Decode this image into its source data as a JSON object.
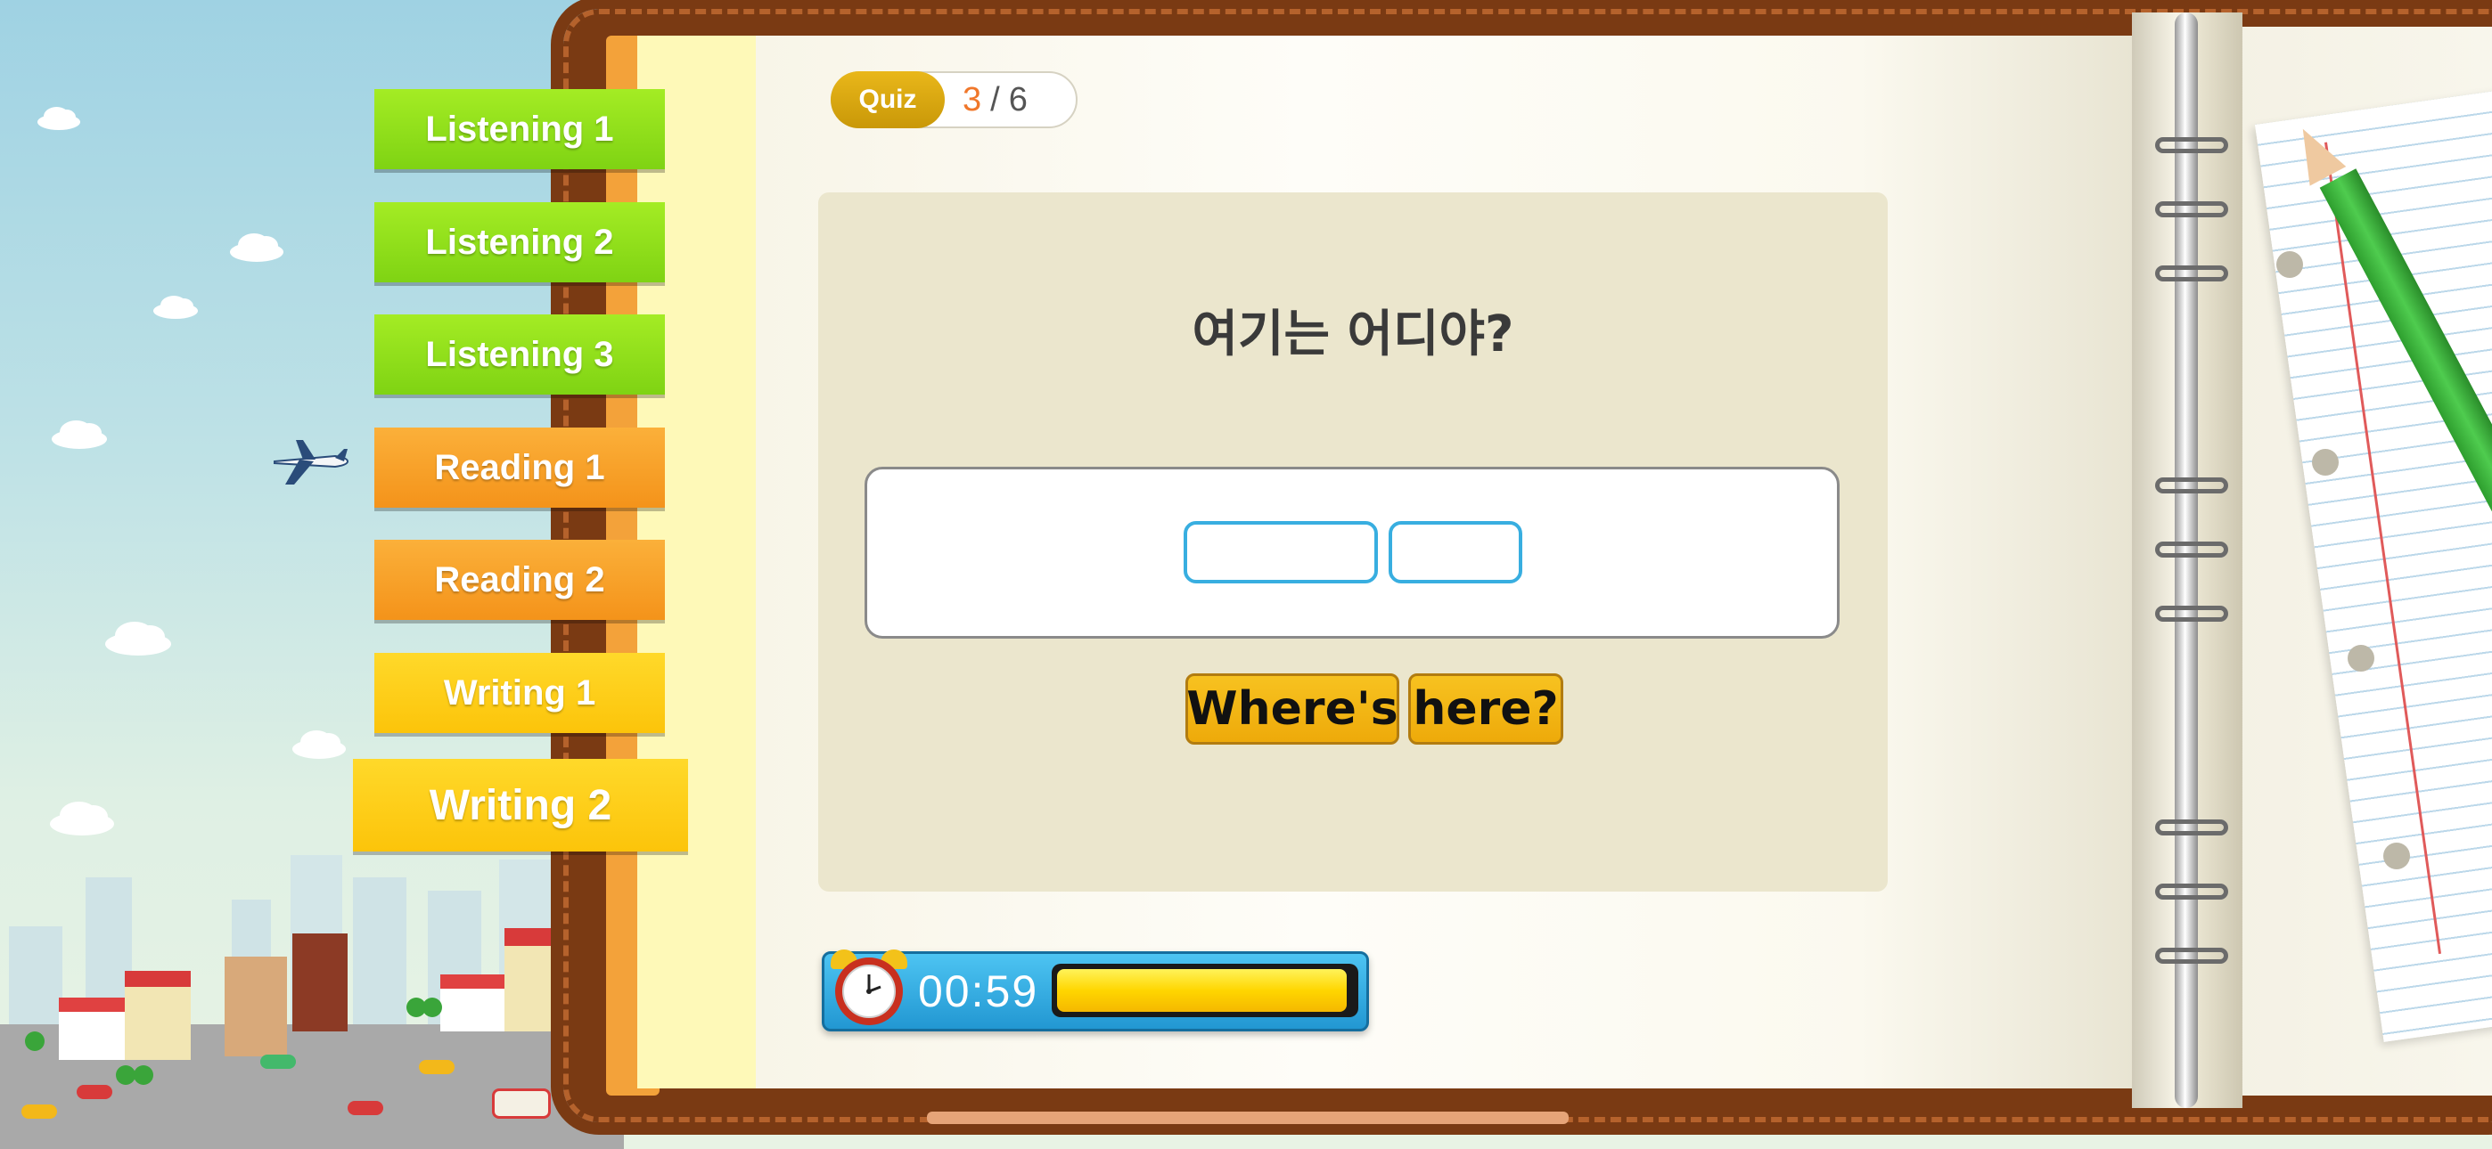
{
  "nav": {
    "tabs": [
      {
        "label": "Listening 1",
        "kind": "listen"
      },
      {
        "label": "Listening 2",
        "kind": "listen"
      },
      {
        "label": "Listening 3",
        "kind": "listen"
      },
      {
        "label": "Reading 1",
        "kind": "read"
      },
      {
        "label": "Reading 2",
        "kind": "read"
      },
      {
        "label": "Writing 1",
        "kind": "write"
      },
      {
        "label": "Writing 2",
        "kind": "write",
        "active": true
      }
    ]
  },
  "quiz": {
    "badge": "Quiz",
    "current": "3",
    "separator": "/",
    "total": "6"
  },
  "question": {
    "prompt": "여기는 어디야?",
    "answer_slots": 2,
    "word_choices": [
      "Where's",
      "here?"
    ]
  },
  "timer": {
    "time": "00:59",
    "progress": 0.98
  },
  "colors": {
    "listening_tab": "#8fe01a",
    "reading_tab": "#f7a02a",
    "writing_tab": "#fdcc14",
    "quiz_current": "#f0772a",
    "slot_border": "#38aee0",
    "word_tile": "#f3b614",
    "timer_panel": "#2aa4dc",
    "timer_fill": "#ffd600"
  },
  "icons": [
    "airplane-icon",
    "alarm-clock-icon",
    "pencil-icon"
  ]
}
